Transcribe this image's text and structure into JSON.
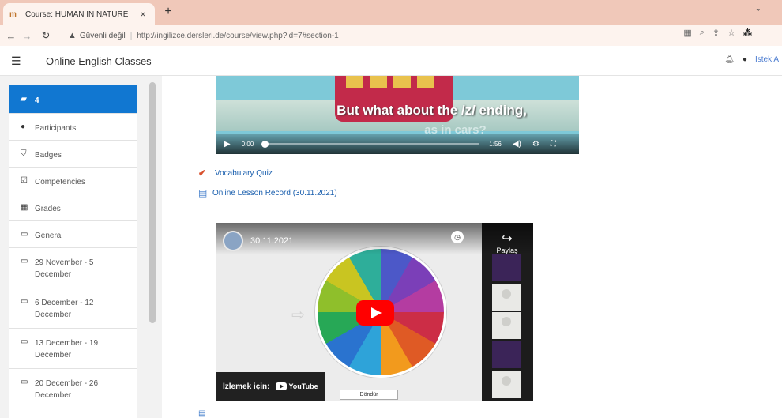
{
  "browser": {
    "tab_title": "Course: HUMAN IN NATURE",
    "close_tab": "×",
    "new_tab": "+",
    "tab_menu": "⌄",
    "insecure_label": "Güvenli değil",
    "url": "http://ingilizce.dersleri.de/course/view.php?id=7#section-1"
  },
  "header": {
    "site_name": "Online English Classes",
    "user_name": "İstek A"
  },
  "sidebar": {
    "items": [
      {
        "label": "4",
        "icon": "graduation-cap-icon",
        "active": true
      },
      {
        "label": "Participants",
        "icon": "users-icon"
      },
      {
        "label": "Badges",
        "icon": "shield-icon"
      },
      {
        "label": "Competencies",
        "icon": "checkbox-icon"
      },
      {
        "label": "Grades",
        "icon": "table-icon"
      },
      {
        "label": "General",
        "icon": "folder-icon"
      },
      {
        "label": "29 November - 5 December",
        "icon": "folder-icon"
      },
      {
        "label": "6 December - 12 December",
        "icon": "folder-icon"
      },
      {
        "label": "13 December - 19 December",
        "icon": "folder-icon"
      },
      {
        "label": "20 December - 26 December",
        "icon": "folder-icon"
      }
    ]
  },
  "video1": {
    "caption_line1": "But what about the /z/ ending,",
    "caption_line2": "as in cars?",
    "current_time": "0:00",
    "duration": "1:56",
    "progress": 0
  },
  "activities": {
    "quiz": "Vocabulary Quiz",
    "record": "Online Lesson Record (30.11.2021)"
  },
  "youtube": {
    "title": "30.11.2021",
    "share_label": "Paylaş",
    "watch_on": "İzlemek için:",
    "logo_text": "YouTube",
    "spin_button": "Döndür"
  }
}
